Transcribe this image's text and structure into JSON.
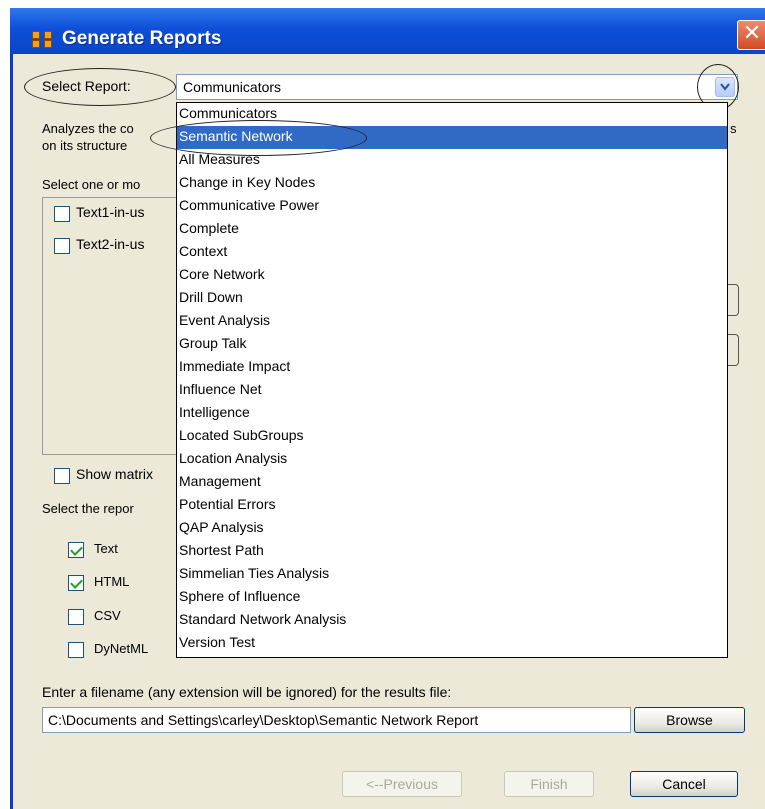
{
  "window": {
    "title": "Generate Reports",
    "close_label": "✕"
  },
  "select_report": {
    "label": "Select Report:",
    "selected": "Communicators"
  },
  "description": {
    "line1": "Analyzes the co",
    "line2": "on its structure",
    "suffix": "s"
  },
  "nodes_prompt": "Select one or mo",
  "meta_networks": [
    {
      "label": "Text1-in-us",
      "checked": false
    },
    {
      "label": "Text2-in-us",
      "checked": false
    }
  ],
  "show_matrix_label": "Show matrix",
  "formats_prompt": "Select the repor",
  "formats": [
    {
      "label": "Text",
      "checked": true
    },
    {
      "label": "HTML",
      "checked": true
    },
    {
      "label": "CSV",
      "checked": false
    },
    {
      "label": "DyNetML",
      "checked": false
    }
  ],
  "report_options": [
    "Communicators",
    "Semantic Network",
    "All Measures",
    "Change in Key Nodes",
    "Communicative Power",
    "Complete",
    "Context",
    "Core Network",
    "Drill Down",
    "Event Analysis",
    "Group Talk",
    "Immediate Impact",
    "Influence Net",
    "Intelligence",
    "Located SubGroups",
    "Location Analysis",
    "Management",
    "Potential Errors",
    "QAP Analysis",
    "Shortest Path",
    "Simmelian Ties Analysis",
    "Sphere of Influence",
    "Standard Network Analysis",
    "Version Test"
  ],
  "highlighted_option": "Semantic Network",
  "filename": {
    "prompt": "Enter a filename (any extension will be ignored) for the results file:",
    "value": "C:\\Documents and Settings\\carley\\Desktop\\Semantic Network Report",
    "browse_label": "Browse"
  },
  "footer": {
    "previous_label": "<--Previous",
    "finish_label": "Finish",
    "cancel_label": "Cancel"
  },
  "colors": {
    "titlebar": "#0a45c8",
    "selection": "#316ac5",
    "dialog_bg": "#ece9d8"
  }
}
